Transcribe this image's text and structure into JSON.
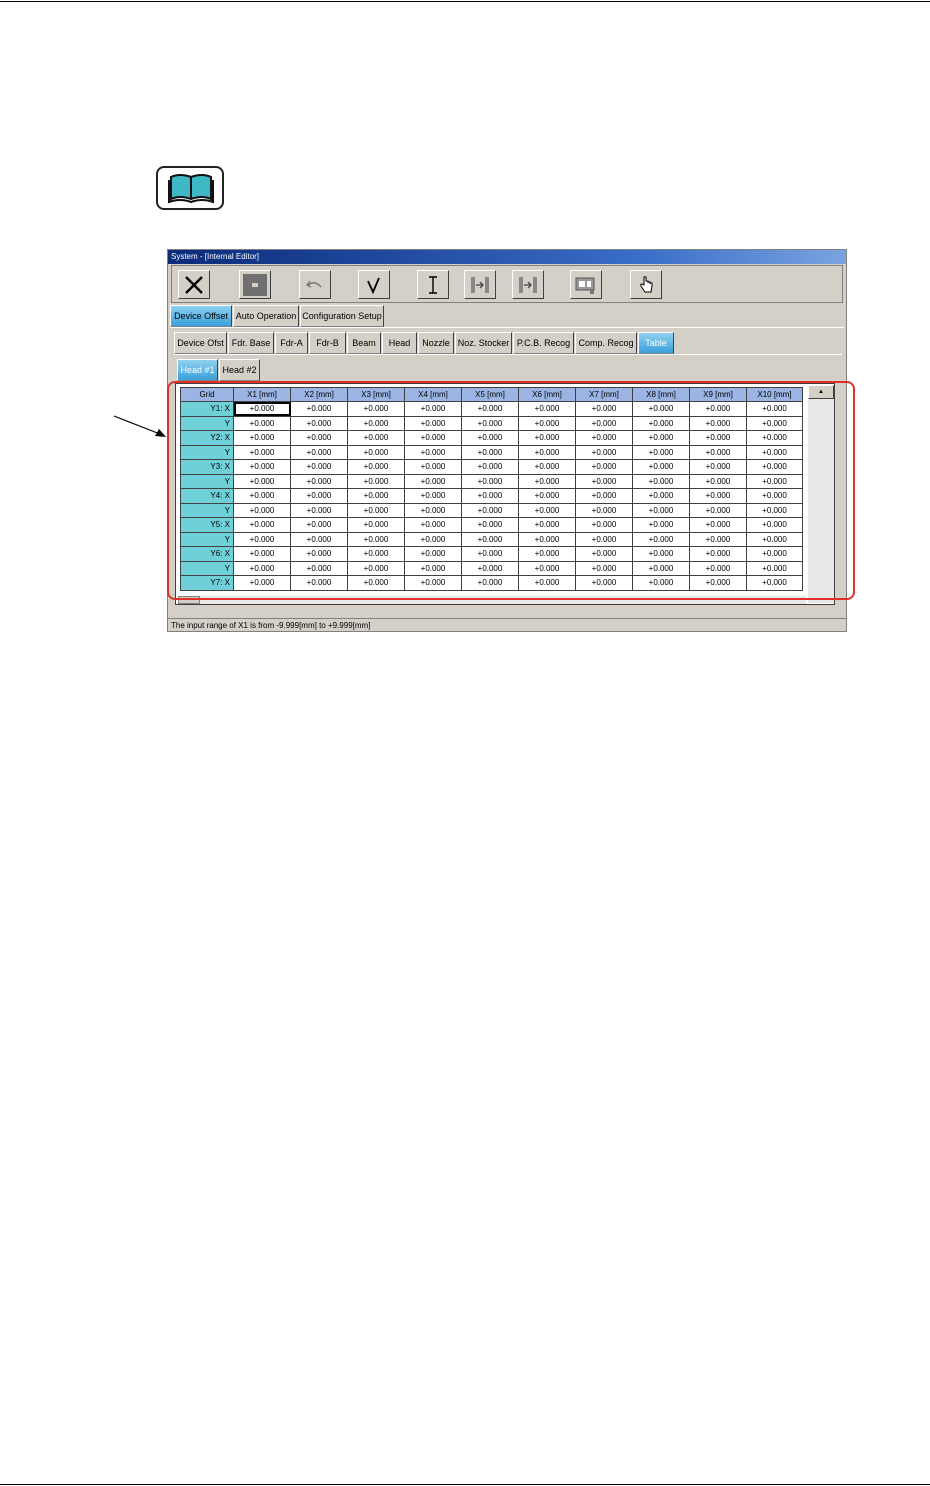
{
  "window": {
    "title": "System - [Internal Editor]"
  },
  "toolbar": {
    "buttons": [
      {
        "name": "close",
        "icon": "close-x-icon"
      },
      {
        "name": "stop",
        "icon": "stop-square-icon"
      },
      {
        "name": "undo",
        "icon": "undo-arrow-icon"
      },
      {
        "name": "confirm",
        "icon": "checkmark-icon"
      },
      {
        "name": "cursor",
        "icon": "text-cursor-icon"
      },
      {
        "name": "jump-first",
        "icon": "jump-first-icon"
      },
      {
        "name": "jump-next",
        "icon": "jump-next-icon"
      },
      {
        "name": "camera",
        "icon": "camera-icon"
      },
      {
        "name": "hand",
        "icon": "hand-pointer-icon"
      }
    ]
  },
  "main_tabs": [
    "Device Offset",
    "Auto Operation",
    "Configuration Setup"
  ],
  "sub_tabs": [
    "Device Ofst",
    "Fdr. Base",
    "Fdr-A",
    "Fdr-B",
    "Beam",
    "Head",
    "Nozzle",
    "Noz. Stocker",
    "P.C.B. Recog",
    "Comp. Recog",
    "Table"
  ],
  "head_tabs": [
    "Head #1",
    "Head #2"
  ],
  "grid": {
    "columns": [
      "Grid",
      "X1 [mm]",
      "X2 [mm]",
      "X3 [mm]",
      "X4 [mm]",
      "X5 [mm]",
      "X6 [mm]",
      "X7 [mm]",
      "X8 [mm]",
      "X9 [mm]",
      "X10 [mm]"
    ],
    "rows": [
      {
        "label": "Y1: X",
        "values": [
          "+0.000",
          "+0.000",
          "+0.000",
          "+0.000",
          "+0.000",
          "+0.000",
          "+0.000",
          "+0.000",
          "+0.000",
          "+0.000"
        ]
      },
      {
        "label": "Y",
        "values": [
          "+0.000",
          "+0.000",
          "+0.000",
          "+0.000",
          "+0.000",
          "+0.000",
          "+0.000",
          "+0.000",
          "+0.000",
          "+0.000"
        ]
      },
      {
        "label": "Y2: X",
        "values": [
          "+0.000",
          "+0.000",
          "+0.000",
          "+0.000",
          "+0.000",
          "+0.000",
          "+0.000",
          "+0.000",
          "+0.000",
          "+0.000"
        ]
      },
      {
        "label": "Y",
        "values": [
          "+0.000",
          "+0.000",
          "+0.000",
          "+0.000",
          "+0.000",
          "+0.000",
          "+0.000",
          "+0.000",
          "+0.000",
          "+0.000"
        ]
      },
      {
        "label": "Y3: X",
        "values": [
          "+0.000",
          "+0.000",
          "+0.000",
          "+0.000",
          "+0.000",
          "+0.000",
          "+0.000",
          "+0.000",
          "+0.000",
          "+0.000"
        ]
      },
      {
        "label": "Y",
        "values": [
          "+0.000",
          "+0.000",
          "+0.000",
          "+0.000",
          "+0.000",
          "+0.000",
          "+0.000",
          "+0.000",
          "+0.000",
          "+0.000"
        ]
      },
      {
        "label": "Y4: X",
        "values": [
          "+0.000",
          "+0.000",
          "+0.000",
          "+0.000",
          "+0.000",
          "+0.000",
          "+0.000",
          "+0.000",
          "+0.000",
          "+0.000"
        ]
      },
      {
        "label": "Y",
        "values": [
          "+0.000",
          "+0.000",
          "+0.000",
          "+0.000",
          "+0.000",
          "+0.000",
          "+0.000",
          "+0.000",
          "+0.000",
          "+0.000"
        ]
      },
      {
        "label": "Y5: X",
        "values": [
          "+0.000",
          "+0.000",
          "+0.000",
          "+0.000",
          "+0.000",
          "+0.000",
          "+0.000",
          "+0.000",
          "+0.000",
          "+0.000"
        ]
      },
      {
        "label": "Y",
        "values": [
          "+0.000",
          "+0.000",
          "+0.000",
          "+0.000",
          "+0.000",
          "+0.000",
          "+0.000",
          "+0.000",
          "+0.000",
          "+0.000"
        ]
      },
      {
        "label": "Y6: X",
        "values": [
          "+0.000",
          "+0.000",
          "+0.000",
          "+0.000",
          "+0.000",
          "+0.000",
          "+0.000",
          "+0.000",
          "+0.000",
          "+0.000"
        ]
      },
      {
        "label": "Y",
        "values": [
          "+0.000",
          "+0.000",
          "+0.000",
          "+0.000",
          "+0.000",
          "+0.000",
          "+0.000",
          "+0.000",
          "+0.000",
          "+0.000"
        ]
      },
      {
        "label": "Y7: X",
        "values": [
          "+0.000",
          "+0.000",
          "+0.000",
          "+0.000",
          "+0.000",
          "+0.000",
          "+0.000",
          "+0.000",
          "+0.000",
          "+0.000"
        ]
      }
    ]
  },
  "status_text": "The input range of X1 is from  -9.999[mm]  to  +9.999[mm]",
  "colors": {
    "highlight_outline": "#e0302a",
    "header_fill": "#9bb4e4",
    "row_label_fill": "#6fd0d8",
    "active_tab": "#3aa0dc"
  },
  "icons": {
    "reference": "manual-book-icon",
    "pointer": "callout-arrow-icon"
  }
}
